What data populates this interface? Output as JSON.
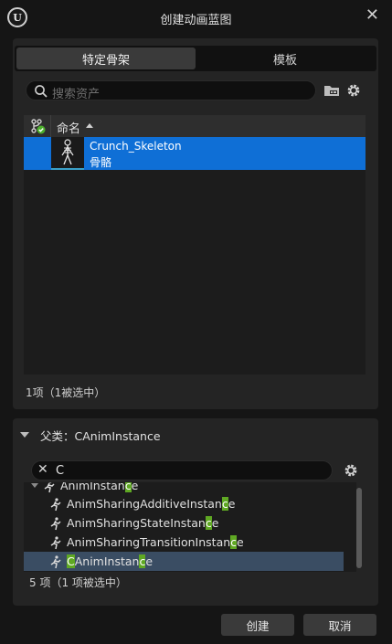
{
  "window": {
    "title": "创建动画蓝图",
    "close_glyph": "✕"
  },
  "tabs": [
    {
      "label": "特定骨架",
      "active": true
    },
    {
      "label": "模板",
      "active": false
    }
  ],
  "asset_search": {
    "placeholder": "搜索资产"
  },
  "asset_list": {
    "column_header": "命名",
    "items": [
      {
        "name": "Crunch_Skeleton",
        "type": "骨骼",
        "selected": true
      }
    ],
    "count_text": "1项（1被选中）"
  },
  "parent_class": {
    "label": "父类：CAnimInstance",
    "filter_value": "C",
    "clear_glyph": "✕",
    "items": [
      {
        "pre": "AnimInstan",
        "hl": "c",
        "post": "e",
        "depth": 0,
        "expanded": true,
        "selected": false
      },
      {
        "pre": "AnimSharingAdditiveInstan",
        "hl": "c",
        "post": "e",
        "depth": 1,
        "selected": false
      },
      {
        "pre": "AnimSharingStateInstan",
        "hl": "c",
        "post": "e",
        "depth": 1,
        "selected": false
      },
      {
        "pre": "AnimSharingTransitionInstan",
        "hl": "c",
        "post": "e",
        "depth": 1,
        "selected": false
      },
      {
        "pre": "",
        "hl": "C",
        "mid": "AnimInstan",
        "hl2": "c",
        "post": "e",
        "depth": 1,
        "selected": true
      }
    ],
    "count_text": "5 项（1 项被选中）"
  },
  "buttons": {
    "create": "创建",
    "cancel": "取消"
  },
  "colors": {
    "selection": "#0f6fd6",
    "class_selection": "#3a4d63",
    "match_highlight": "#5fa823",
    "source_control": "#4caf2c"
  }
}
